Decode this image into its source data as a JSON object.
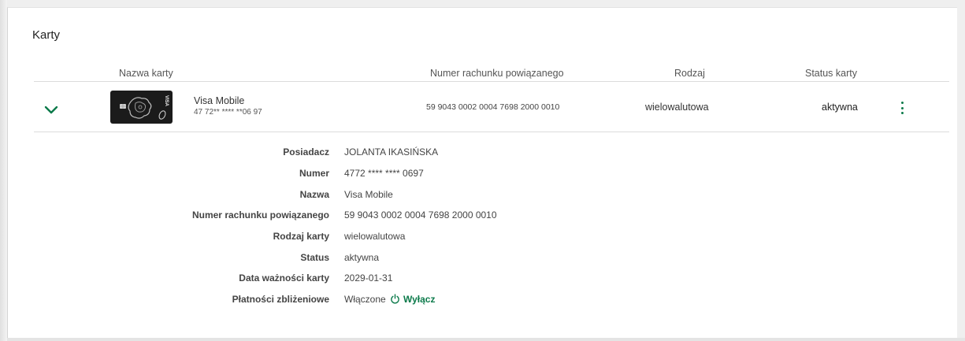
{
  "section": {
    "title": "Karty"
  },
  "table": {
    "headers": {
      "name": "Nazwa karty",
      "account": "Numer rachunku powiązanego",
      "type": "Rodzaj",
      "status": "Status karty"
    },
    "row": {
      "card_name": "Visa Mobile",
      "card_number_masked": "47 72** **** **06 97",
      "account": "59 9043 0002 0004 7698 2000 0010",
      "type": "wielowalutowa",
      "status": "aktywna",
      "card_brand_label": "VISA"
    }
  },
  "details": [
    {
      "label": "Posiadacz",
      "value": "JOLANTA IKASIŃSKA"
    },
    {
      "label": "Numer",
      "value": "4772 **** **** 0697"
    },
    {
      "label": "Nazwa",
      "value": "Visa Mobile"
    },
    {
      "label": "Numer rachunku powiązanego",
      "value": "59 9043 0002 0004 7698 2000 0010"
    },
    {
      "label": "Rodzaj karty",
      "value": "wielowalutowa"
    },
    {
      "label": "Status",
      "value": "aktywna"
    },
    {
      "label": "Data ważności karty",
      "value": "2029-01-31"
    },
    {
      "label": "Płatności zbliżeniowe",
      "value": "Włączone"
    }
  ],
  "contactless": {
    "action_label": "Wyłącz",
    "icon": "power-icon"
  },
  "colors": {
    "accent": "#0b7a4a",
    "card_background": "#1b1b1b"
  }
}
